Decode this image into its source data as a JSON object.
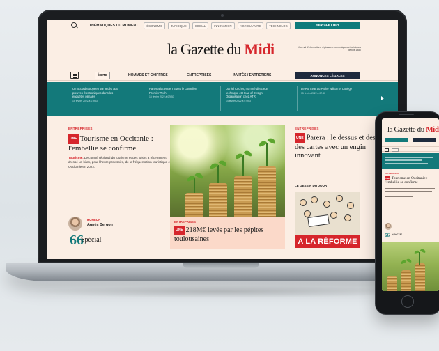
{
  "topbar": {
    "themes_label": "THÉMATIQUES DU MOMENT",
    "chips": [
      "ÉCONOMIE",
      "JURIDIQUE",
      "SOCIAL",
      "INNOVATION",
      "AGRICULTURE",
      "TECHNOLOG"
    ],
    "newsletter_label": "NEWSLETTER"
  },
  "masthead": {
    "logo_main": "la Gazette du ",
    "logo_accent": "Midi",
    "tagline": "Journal d'informations régionales économiques et juridiques depuis 1880"
  },
  "nav": {
    "edito": "ÉDITO",
    "items": [
      "HOMMES ET CHIFFRES",
      "ENTREPRISES",
      "INVITÉS / ENTRETIENS"
    ],
    "annonces_label": "ANNONCES LÉGALES"
  },
  "ticker": [
    {
      "text": "Un accord européen sur accès aux preuves Électroniques dans les enquêtes pénales",
      "date": "15 février 2022 à 07h53"
    },
    {
      "text": "Partenariat entre TBM et le canadien Premier Tech",
      "date": "15 février 2022 à 07h53"
    },
    {
      "text": "Daniel Cuchet, nommé directeur technique et Head of Design Organisation chez ATR",
      "date": "14 février 2022 à 07h53"
    },
    {
      "text": "Le Roi Lear au Pathé Wilson et Labège",
      "date": "15 février 2022 à 07:30"
    }
  ],
  "left_article": {
    "kicker": "ENTREPRISES",
    "badge": "UNE",
    "headline": "Tourisme en Occitanie : l'embellie se confirme",
    "lead_bold": "Tourisme.",
    "lead": " Le comité régional du tourisme et des loisirs a récemment dressé un bilan, pour l'heure provisoire, de la fréquentation touristique en Occitanie en 2022."
  },
  "humeur": {
    "kicker": "HUMEUR",
    "author": "Agnès Bergon",
    "quote_mark": "66",
    "title": "Spécial"
  },
  "mid_article": {
    "kicker": "ENTREPRISES",
    "badge": "UNE",
    "headline": "218M€ levés par les pépites toulousaines"
  },
  "right_article": {
    "kicker": "ENTREPRISES",
    "badge": "UNE",
    "headline": "Parera : le dessus et dessous des cartes avec un engin innovant"
  },
  "dessin": {
    "title": "LE DESSIN DU JOUR",
    "banner": "A LA RÉFORME"
  },
  "phone": {
    "logo_main": "la Gazette du ",
    "logo_accent": "Midi",
    "kicker": "ENTREPRISES",
    "badge": "UNE",
    "headline": "Tourisme en Occitanie : l'embellie se confirme",
    "humeur_title": "Spécial",
    "quote_mark": "66"
  },
  "colors": {
    "accent_red": "#d6262c",
    "teal": "#13797a",
    "navy": "#1e2a3d",
    "page_bg": "#fbeee4"
  }
}
